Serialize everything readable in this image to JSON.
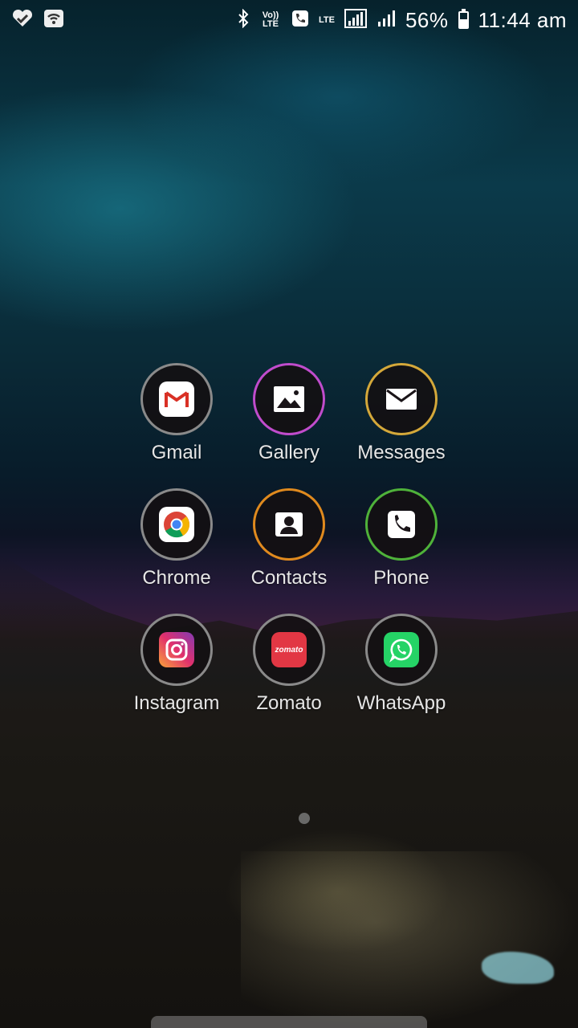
{
  "status_bar": {
    "left_icons": [
      "heart-check-icon",
      "wifi-icon"
    ],
    "volte_label": "Vo)) LTE",
    "lte_label": "LTE",
    "battery_percent": "56%",
    "battery_level": 0.56,
    "time": "11:44 am"
  },
  "apps": [
    {
      "label": "Gmail",
      "ring_color": "#8a8a8a",
      "icon": "gmail-icon"
    },
    {
      "label": "Gallery",
      "ring_color": "#c04ccc",
      "icon": "image-icon"
    },
    {
      "label": "Messages",
      "ring_color": "#d4a83a",
      "icon": "envelope-icon"
    },
    {
      "label": "Chrome",
      "ring_color": "#8a8a8a",
      "icon": "chrome-icon"
    },
    {
      "label": "Contacts",
      "ring_color": "#e08a1e",
      "icon": "person-icon"
    },
    {
      "label": "Phone",
      "ring_color": "#4fb23a",
      "icon": "phone-icon"
    },
    {
      "label": "Instagram",
      "ring_color": "#8a8a8a",
      "icon": "instagram-icon"
    },
    {
      "label": "Zomato",
      "ring_color": "#8a8a8a",
      "icon": "zomato-icon",
      "icon_text": "zomato"
    },
    {
      "label": "WhatsApp",
      "ring_color": "#8a8a8a",
      "icon": "whatsapp-icon"
    }
  ]
}
